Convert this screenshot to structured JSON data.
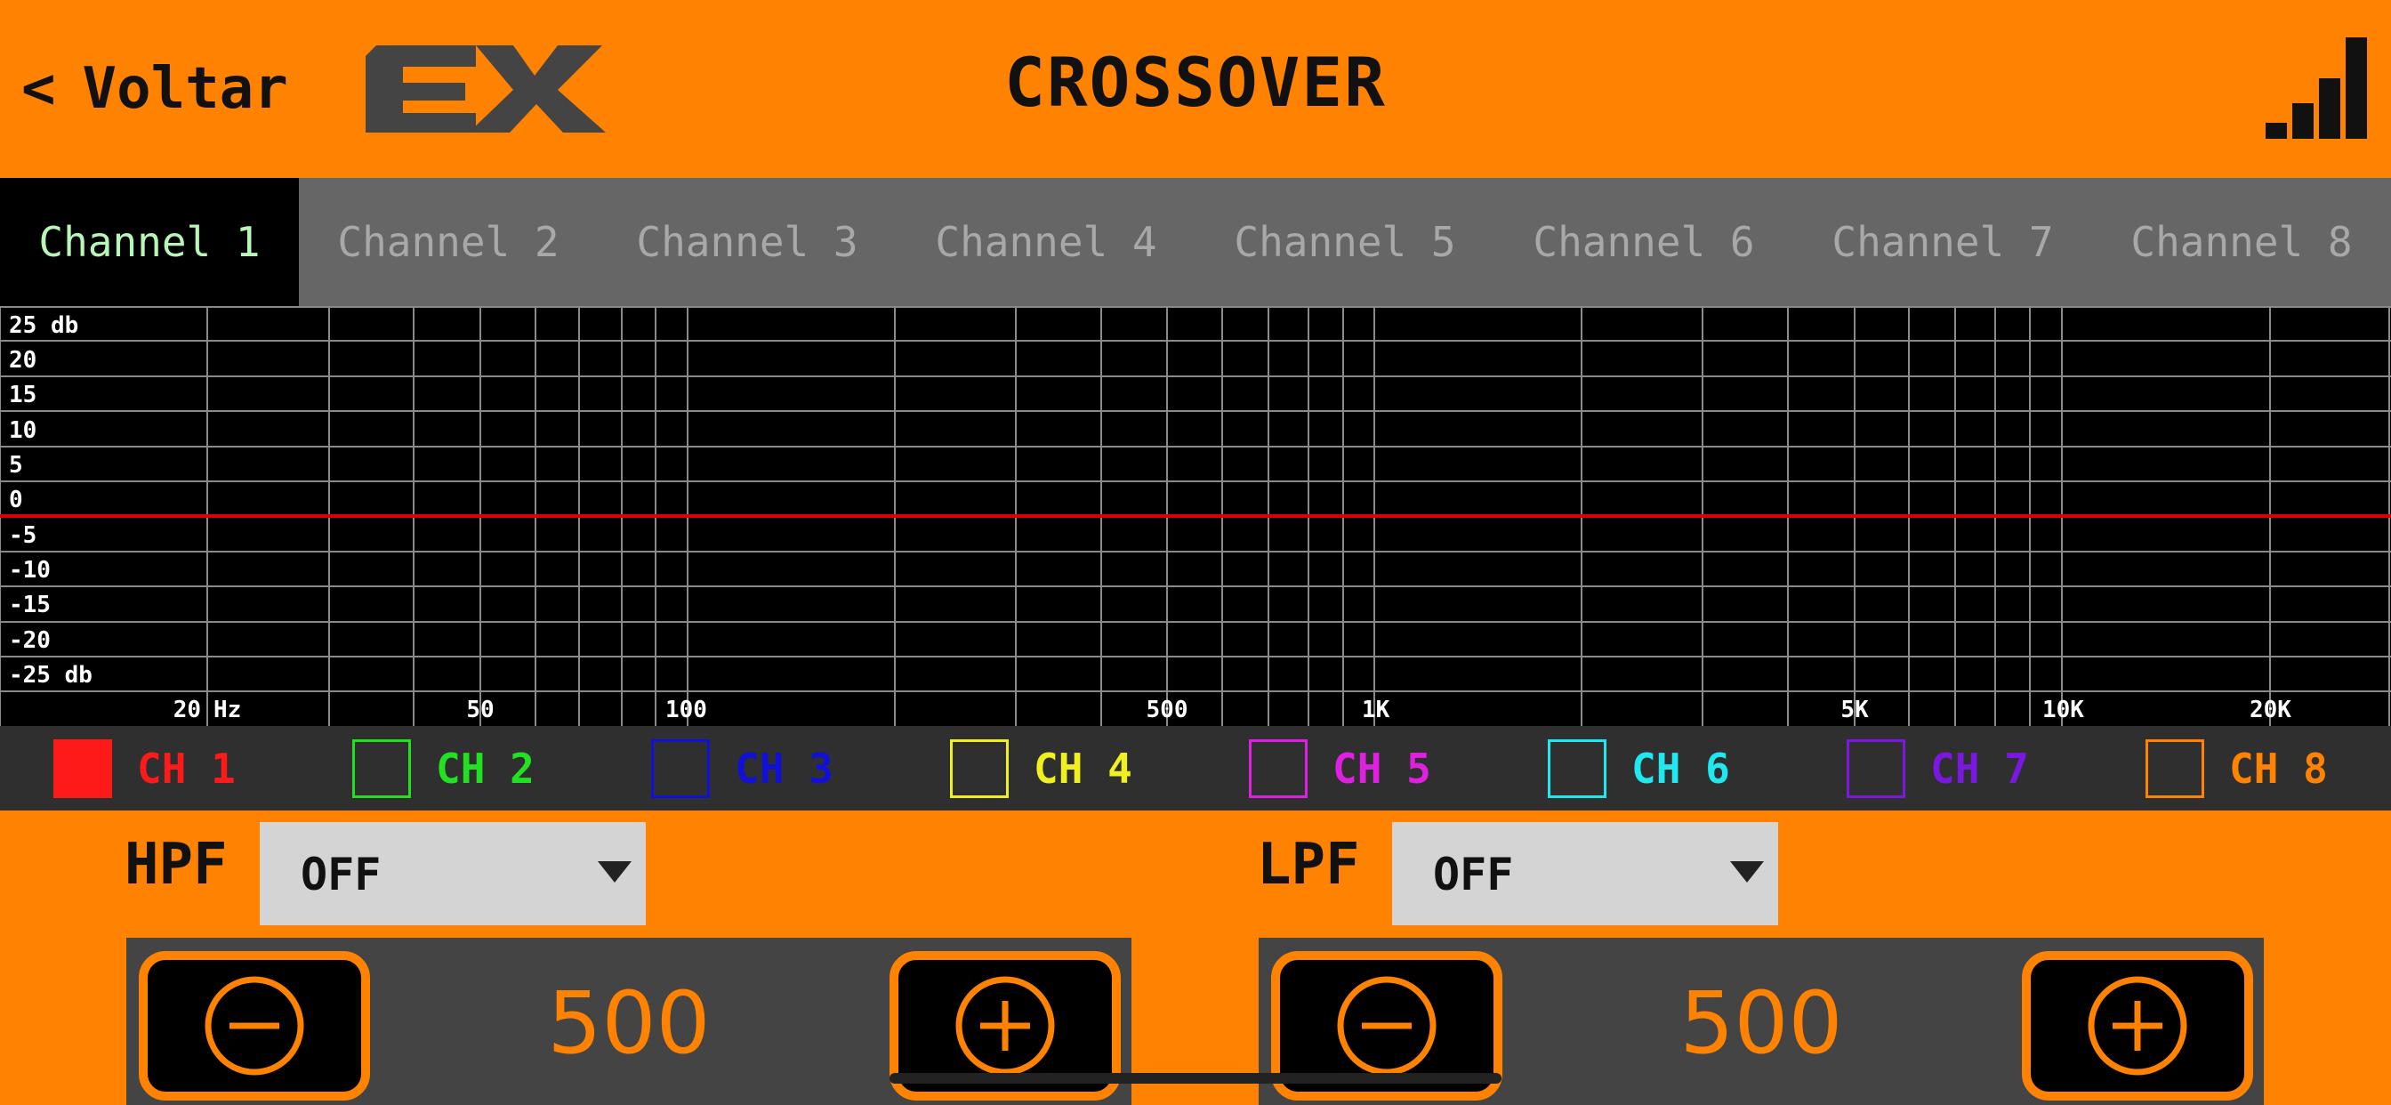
{
  "header": {
    "back_label": "Voltar",
    "title": "CROSSOVER",
    "logo_text": "EX"
  },
  "tabs": [
    {
      "label": "Channel 1",
      "active": true
    },
    {
      "label": "Channel 2",
      "active": false
    },
    {
      "label": "Channel 3",
      "active": false
    },
    {
      "label": "Channel 4",
      "active": false
    },
    {
      "label": "Channel 5",
      "active": false
    },
    {
      "label": "Channel 6",
      "active": false
    },
    {
      "label": "Channel 7",
      "active": false
    },
    {
      "label": "Channel 8",
      "active": false
    }
  ],
  "graph": {
    "db_labels": [
      "25 db",
      "20",
      "15",
      "10",
      "5",
      "0",
      "-5",
      "-10",
      "-15",
      "-20",
      "-25 db"
    ],
    "freq_labels": [
      "20",
      "Hz",
      "50",
      "100",
      "500",
      "1K",
      "5K",
      "10K",
      "20K"
    ],
    "zero_line_color": "#e00000"
  },
  "legend": [
    {
      "label": "CH 1",
      "color": "#ff1a1a",
      "checked": true
    },
    {
      "label": "CH 2",
      "color": "#22e022",
      "checked": false
    },
    {
      "label": "CH 3",
      "color": "#1010d8",
      "checked": false
    },
    {
      "label": "CH 4",
      "color": "#f0f020",
      "checked": false
    },
    {
      "label": "CH 5",
      "color": "#e020e0",
      "checked": false
    },
    {
      "label": "CH 6",
      "color": "#20e8f0",
      "checked": false
    },
    {
      "label": "CH 7",
      "color": "#7a18e0",
      "checked": false
    },
    {
      "label": "CH 8",
      "color": "#ff8200",
      "checked": false
    }
  ],
  "hpf": {
    "label": "HPF",
    "selected": "OFF",
    "value": "500"
  },
  "lpf": {
    "label": "LPF",
    "selected": "OFF",
    "value": "500"
  },
  "colors": {
    "accent": "#FF8200",
    "tab_bar": "#666666",
    "stepper_bg": "#444444"
  },
  "icons": {
    "back": "chevron-left-icon",
    "signal": "signal-bars-icon",
    "minus": "minus-circle-icon",
    "plus": "plus-circle-icon"
  }
}
